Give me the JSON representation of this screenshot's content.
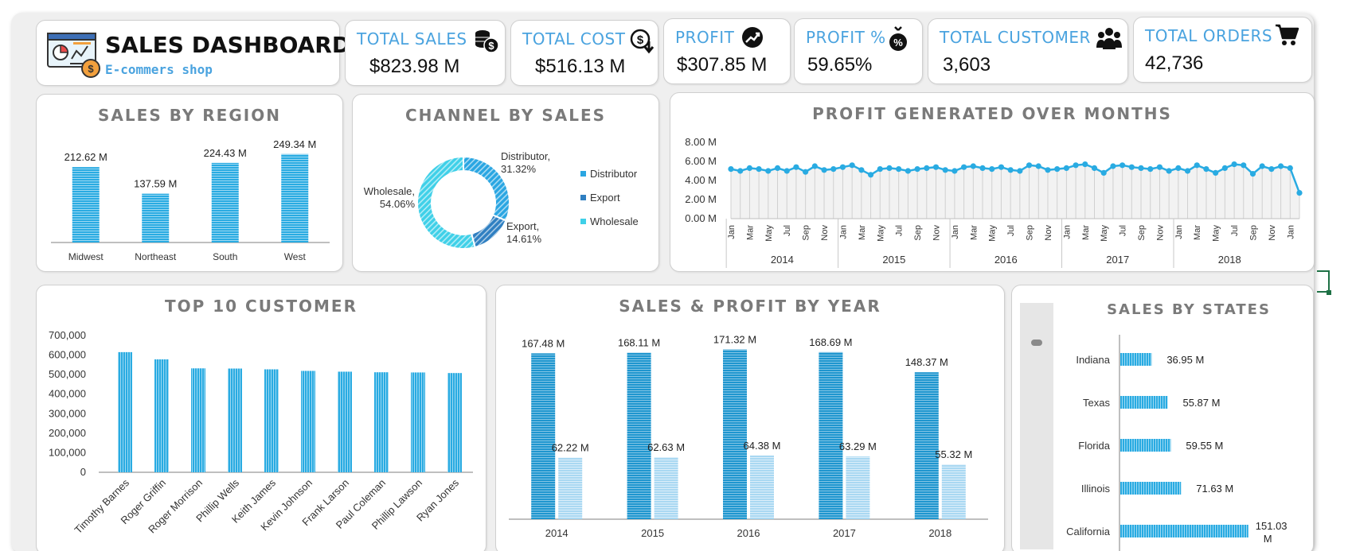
{
  "header": {
    "title": "SALES DASHBOARD",
    "subtitle": "E-commers shop"
  },
  "kpis": [
    {
      "label": "TOTAL SALES",
      "value": "$823.98 M",
      "icon": "coins-dollar-icon"
    },
    {
      "label": "TOTAL COST",
      "value": "$516.13 M",
      "icon": "dollar-down-arrow-icon"
    },
    {
      "label": "PROFIT",
      "value": "$307.85 M",
      "icon": "trending-up-icon"
    },
    {
      "label": "PROFIT %",
      "value": "59.65%",
      "icon": "percent-bag-icon"
    },
    {
      "label": "TOTAL CUSTOMER",
      "value": "3,603",
      "icon": "people-group-icon"
    },
    {
      "label": "TOTAL ORDERS",
      "value": "42,736",
      "icon": "shopping-cart-icon"
    }
  ],
  "colors": {
    "bar_primary": "#29abe2",
    "bar_dark": "#1f96cf",
    "bar_light": "#a9d8f2",
    "accent_text": "#4aa3df",
    "distributor": "#2aa6e2",
    "export": "#2f7fc1",
    "wholesale": "#3fd0e8"
  },
  "chart_data": [
    {
      "id": "region",
      "type": "bar",
      "title": "SALES BY REGION",
      "categories": [
        "Midwest",
        "Northeast",
        "South",
        "West"
      ],
      "values": [
        212.62,
        137.59,
        224.43,
        249.34
      ],
      "labels": [
        "212.62 M",
        "137.59 M",
        "224.43 M",
        "249.34 M"
      ],
      "ylim": [
        0,
        260
      ]
    },
    {
      "id": "channel",
      "type": "pie",
      "title": "CHANNEL BY SALES",
      "categories": [
        "Distributor",
        "Export",
        "Wholesale"
      ],
      "values": [
        31.32,
        14.61,
        54.06
      ],
      "slice_labels": [
        [
          "Distributor,",
          "31.32%"
        ],
        [
          "Export,",
          "14.61%"
        ],
        [
          "Wholesale,",
          "54.06%"
        ]
      ],
      "legend": [
        "Distributor",
        "Export",
        "Wholesale"
      ],
      "legend_position": "right"
    },
    {
      "id": "months",
      "type": "line",
      "title": "PROFIT GENERATED OVER MONTHS",
      "y_ticks": [
        "0.00 M",
        "2.00 M",
        "4.00 M",
        "6.00 M",
        "8.00 M"
      ],
      "ylim": [
        0,
        8
      ],
      "month_ticks": [
        "Jan",
        "Mar",
        "May",
        "Jul",
        "Sep",
        "Nov"
      ],
      "years": [
        "2014",
        "2015",
        "2016",
        "2017",
        "2018"
      ],
      "values": [
        5.2,
        5.0,
        5.3,
        5.2,
        5.0,
        5.3,
        5.0,
        5.4,
        4.9,
        5.5,
        5.1,
        5.2,
        5.4,
        5.6,
        5.1,
        4.6,
        5.2,
        5.3,
        5.2,
        5.0,
        5.2,
        5.3,
        5.4,
        5.1,
        5.0,
        5.4,
        5.5,
        5.3,
        5.2,
        5.4,
        5.1,
        5.0,
        5.6,
        5.5,
        5.1,
        5.2,
        5.3,
        5.6,
        5.7,
        5.3,
        4.8,
        5.5,
        5.6,
        5.4,
        5.3,
        5.2,
        5.4,
        5.0,
        5.3,
        5.0,
        5.6,
        5.2,
        4.8,
        5.3,
        5.7,
        5.6,
        4.7,
        5.5,
        5.2,
        5.5,
        5.3,
        2.7
      ],
      "grid": true
    },
    {
      "id": "customers",
      "type": "bar",
      "title": "TOP 10 CUSTOMER",
      "categories": [
        "Timothy Barnes",
        "Roger Griffin",
        "Roger Morrison",
        "Phillip Wells",
        "Keith James",
        "Kevin Johnson",
        "Frank Larson",
        "Paul Coleman",
        "Phillip Lawson",
        "Ryan Jones"
      ],
      "values": [
        615000,
        578000,
        532000,
        531000,
        527000,
        519000,
        515000,
        512000,
        511000,
        508000
      ],
      "y_ticks": [
        "0",
        "100,000",
        "200,000",
        "300,000",
        "400,000",
        "500,000",
        "600,000",
        "700,000"
      ],
      "ylim": [
        0,
        700000
      ]
    },
    {
      "id": "yearly",
      "type": "bar",
      "title": "SALES & PROFIT BY YEAR",
      "categories": [
        "2014",
        "2015",
        "2016",
        "2017",
        "2018"
      ],
      "series": [
        {
          "values": [
            167.48,
            168.11,
            171.32,
            168.69,
            148.37
          ],
          "labels": [
            "167.48 M",
            "168.11 M",
            "171.32 M",
            "168.69 M",
            "148.37 M"
          ]
        },
        {
          "values": [
            62.22,
            62.63,
            64.38,
            63.29,
            55.32
          ],
          "labels": [
            "62.22 M",
            "62.63 M",
            "64.38 M",
            "63.29 M",
            "55.32 M"
          ]
        }
      ],
      "ylim": [
        0,
        175
      ]
    },
    {
      "id": "states",
      "type": "bar",
      "orientation": "horizontal",
      "title": "SALES BY STATES",
      "categories": [
        "Indiana",
        "Texas",
        "Florida",
        "Illinois",
        "California"
      ],
      "values": [
        36.95,
        55.87,
        59.55,
        71.63,
        151.03
      ],
      "labels": [
        "36.95 M",
        "55.87 M",
        "59.55 M",
        "71.63 M",
        "151.03 M"
      ],
      "xlim": [
        0,
        155
      ]
    }
  ]
}
